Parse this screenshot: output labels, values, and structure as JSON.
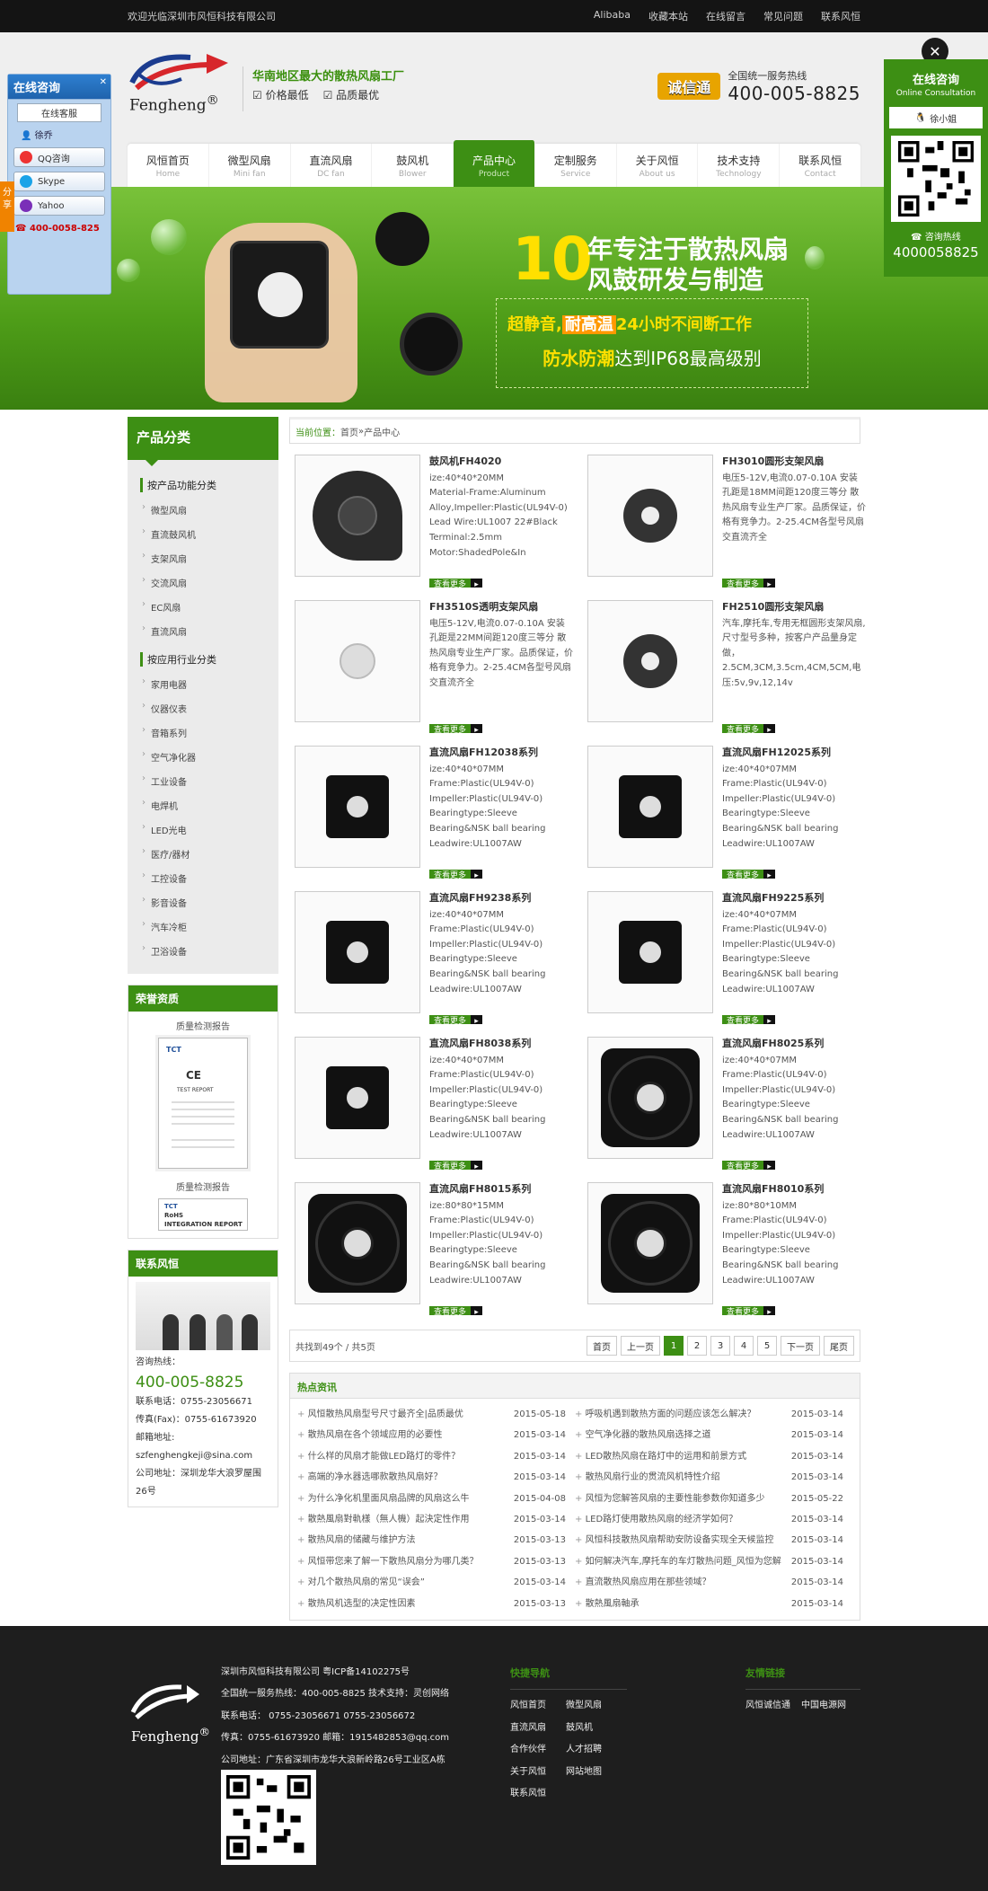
{
  "topbar": {
    "welcome": "欢迎光临深圳市风恒科技有限公司",
    "links": [
      "Alibaba",
      "收藏本站",
      "在线留言",
      "常见问题",
      "联系风恒"
    ]
  },
  "header": {
    "logo_name": "Fengheng",
    "logo_mark": "®",
    "slogan": "华南地区最大的散热风扇工厂",
    "slogan_points": [
      "☑ 价格最低",
      "☑ 品质最优"
    ],
    "badge": "诚信通",
    "hotline_label": "全国统一服务热线",
    "hotline": "400-005-8825"
  },
  "nav": [
    {
      "cn": "风恒首页",
      "en": "Home"
    },
    {
      "cn": "微型风扇",
      "en": "Mini fan"
    },
    {
      "cn": "直流风扇",
      "en": "DC fan"
    },
    {
      "cn": "鼓风机",
      "en": "Blower"
    },
    {
      "cn": "产品中心",
      "en": "Product"
    },
    {
      "cn": "定制服务",
      "en": "Service"
    },
    {
      "cn": "关于风恒",
      "en": "About us"
    },
    {
      "cn": "技术支持",
      "en": "Technology"
    },
    {
      "cn": "联系风恒",
      "en": "Contact"
    }
  ],
  "banner": {
    "big": "10",
    "t1": "年专注于散热风扇",
    "t2": "风鼓研发与制造",
    "l1a": "超静音,",
    "l1b": "耐高温",
    "l1c": "24小时不间断工作",
    "l2a": "防水防潮",
    "l2b": "达到IP68最高级别"
  },
  "sidebar": {
    "title": "产品分类",
    "group1": "按产品功能分类",
    "items1": [
      "微型风扇",
      "直流鼓风机",
      "支架风扇",
      "交流风扇",
      "EC风扇",
      "直流风扇"
    ],
    "group2": "按应用行业分类",
    "items2": [
      "家用电器",
      "仪器仪表",
      "音箱系列",
      "空气净化器",
      "工业设备",
      "电焊机",
      "LED光电",
      "医疗/器材",
      "工控设备",
      "影音设备",
      "汽车冷柜",
      "卫浴设备"
    ],
    "honor_title": "荣誉资质",
    "cert_caption": "质量检测报告",
    "cert_caption2": "质量检测报告",
    "cert_tct": "TCT",
    "cert_ce": "CE",
    "cert_report": "TEST REPORT",
    "cert_rohs": "RoHS",
    "cert_integration": "INTEGRATION REPORT",
    "contact_title": "联系风恒",
    "contact_hotline_label": "咨询热线：",
    "contact_hotline": "400-005-8825",
    "contact_phone": "联系电话：0755-23056671",
    "contact_fax": "传真(Fax)：0755-61673920",
    "contact_email_label": "邮箱地址:",
    "contact_email": "szfenghengkeji@sina.com",
    "contact_addr": "公司地址：深圳龙华大浪罗屋围26号"
  },
  "crumb": {
    "label": "当前位置：",
    "home": "首页",
    "sep": " » ",
    "current": "产品中心"
  },
  "more_label": "查看更多",
  "products": [
    {
      "title": "鼓风机FH4020",
      "desc": "ize:40*40*20MM\nMaterial-Frame:Aluminum Alloy,Impeller:Plastic(UL94V-0)\nLead Wire:UL1007 22#Black\nTerminal:2.5mm\nMotor:ShadedPole&In",
      "pic": "blower"
    },
    {
      "title": "FH3010圆形支架风扇",
      "desc": "电压5-12V,电流0.07-0.10A 安装孔距是18MM间距120度三等分 散热风扇专业生产厂家。品质保证，价格有竞争力。2-25.4CM各型号风扇交直流齐全",
      "pic": "tiny"
    },
    {
      "title": "FH3510S透明支架风扇",
      "desc": "电压5-12V,电流0.07-0.10A 安装孔距是22MM间距120度三等分 散热风扇专业生产厂家。品质保证，价格有竞争力。2-25.4CM各型号风扇交直流齐全",
      "pic": "coin"
    },
    {
      "title": "FH2510圆形支架风扇",
      "desc": "汽车,摩托车,专用无框圆形支架风扇,尺寸型号多种，按客户产品量身定做，2.5CM,3CM,3.5cm,4CM,5CM,电压:5v,9v,12,14v",
      "pic": "tiny"
    },
    {
      "title": "直流风扇FH12038系列",
      "desc": "ize:40*40*07MM\nFrame:Plastic(UL94V-0)\nImpeller:Plastic(UL94V-0)\nBearingtype:Sleeve Bearing&NSK ball bearing\nLeadwire:UL1007AW",
      "pic": "fan"
    },
    {
      "title": "直流风扇FH12025系列",
      "desc": "ize:40*40*07MM\nFrame:Plastic(UL94V-0)\nImpeller:Plastic(UL94V-0)\nBearingtype:Sleeve Bearing&NSK ball bearing\nLeadwire:UL1007AW",
      "pic": "fan"
    },
    {
      "title": "直流风扇FH9238系列",
      "desc": "ize:40*40*07MM\nFrame:Plastic(UL94V-0)\nImpeller:Plastic(UL94V-0)\nBearingtype:Sleeve Bearing&NSK ball bearing\nLeadwire:UL1007AW",
      "pic": "fan"
    },
    {
      "title": "直流风扇FH9225系列",
      "desc": "ize:40*40*07MM\nFrame:Plastic(UL94V-0)\nImpeller:Plastic(UL94V-0)\nBearingtype:Sleeve Bearing&NSK ball bearing\nLeadwire:UL1007AW",
      "pic": "fan"
    },
    {
      "title": "直流风扇FH8038系列",
      "desc": "ize:40*40*07MM\nFrame:Plastic(UL94V-0)\nImpeller:Plastic(UL94V-0)\nBearingtype:Sleeve Bearing&NSK ball bearing\nLeadwire:UL1007AW",
      "pic": "fan"
    },
    {
      "title": "直流风扇FH8025系列",
      "desc": "ize:40*40*07MM\nFrame:Plastic(UL94V-0)\nImpeller:Plastic(UL94V-0)\nBearingtype:Sleeve Bearing&NSK ball bearing\nLeadwire:UL1007AW",
      "pic": "bigfan"
    },
    {
      "title": "直流风扇FH8015系列",
      "desc": "ize:80*80*15MM\nFrame:Plastic(UL94V-0)\nImpeller:Plastic(UL94V-0)\nBearingtype:Sleeve Bearing&NSK ball bearing\nLeadwire:UL1007AW",
      "pic": "bigfan"
    },
    {
      "title": "直流风扇FH8010系列",
      "desc": "ize:80*80*10MM\nFrame:Plastic(UL94V-0)\nImpeller:Plastic(UL94V-0)\nBearingtype:Sleeve Bearing&NSK ball bearing\nLeadwire:UL1007AW",
      "pic": "bigfan"
    }
  ],
  "pager": {
    "summary": "共找到49个 / 共5页",
    "first": "首页",
    "prev": "上一页",
    "pages": [
      "1",
      "2",
      "3",
      "4",
      "5"
    ],
    "next": "下一页",
    "last": "尾页"
  },
  "news": {
    "title": "热点资讯",
    "left": [
      {
        "t": "风恒散热风扇型号尺寸最齐全|品质最优",
        "d": "2015-05-18"
      },
      {
        "t": "散热风扇在各个领域应用的必要性",
        "d": "2015-03-14"
      },
      {
        "t": "什么样的风扇才能做LED路灯的零件？",
        "d": "2015-03-14"
      },
      {
        "t": "高端的净水器选哪款散热风扇好？",
        "d": "2015-03-14"
      },
      {
        "t": "为什么净化机里面风扇品牌的风扇这么牛",
        "d": "2015-04-08"
      },
      {
        "t": "散熱風扇對軌樣（無人機）起決定性作用",
        "d": "2015-03-14"
      },
      {
        "t": "散热风扇的储藏与维护方法",
        "d": "2015-03-13"
      },
      {
        "t": "风恒带您来了解一下散热风扇分为哪几类？",
        "d": "2015-03-13"
      },
      {
        "t": "对几个散热风扇的常见“误会”",
        "d": "2015-03-14"
      },
      {
        "t": "散热风机选型的决定性因素",
        "d": "2015-03-13"
      }
    ],
    "right": [
      {
        "t": "呼吸机遇到散热方面的问题应该怎么解决？",
        "d": "2015-03-14"
      },
      {
        "t": "空气净化器的散热风扇选择之道",
        "d": "2015-03-14"
      },
      {
        "t": "LED散热风扇在路灯中的运用和前景方式",
        "d": "2015-03-14"
      },
      {
        "t": "散热风扇行业的贯流风机特性介绍",
        "d": "2015-03-14"
      },
      {
        "t": "风恒为您解答风扇的主要性能参数你知道多少",
        "d": "2015-05-22"
      },
      {
        "t": "LED路灯使用散热风扇的经济学如何？",
        "d": "2015-03-14"
      },
      {
        "t": "风恒科技散热风扇帮助安防设备实现全天候监控",
        "d": "2015-03-14"
      },
      {
        "t": "如何解决汽车,摩托车的车灯散热问题_风恒为您解",
        "d": "2015-03-14"
      },
      {
        "t": "直流散热风扇应用在那些领域？",
        "d": "2015-03-14"
      },
      {
        "t": "散熱風扇軸承",
        "d": "2015-03-14"
      }
    ]
  },
  "footer": {
    "logo_name": "Fengheng",
    "logo_mark": "®",
    "lines": [
      "深圳市风恒科技有限公司 粤ICP备14102275号",
      "全国统一服务热线：400-005-8825  技术支持：灵创网络",
      "联系电话： 0755-23056671       0755-23056672",
      "传真：0755-61673920 邮箱：1915482853@qq.com",
      "公司地址：广东省深圳市龙华大浪新岭路26号工业区A栋"
    ],
    "nav_title": "快捷导航",
    "nav": [
      "风恒首页",
      "微型风扇",
      "直流风扇",
      "鼓风机",
      "合作伙伴",
      "人才招聘",
      "关于风恒",
      "网站地图",
      "联系风恒"
    ],
    "link_title": "友情链接",
    "links": [
      "风恒诚信通",
      "中国电源网"
    ]
  },
  "qq": {
    "title": "在线咨询",
    "sub": "在线客服",
    "user": "徐乔",
    "buttons": [
      "QQ咨询",
      "Skype",
      "Yahoo"
    ],
    "phone": "400-0058-825",
    "share": "分享"
  },
  "online": {
    "title": "在线咨询",
    "en": "Online Consultation",
    "user": "徐小姐",
    "hotline_label": "☎ 咨询热线",
    "hotline": "4000058825"
  },
  "colors": {
    "brand_green": "#3d8f14",
    "accent_yellow": "#ffe000"
  }
}
